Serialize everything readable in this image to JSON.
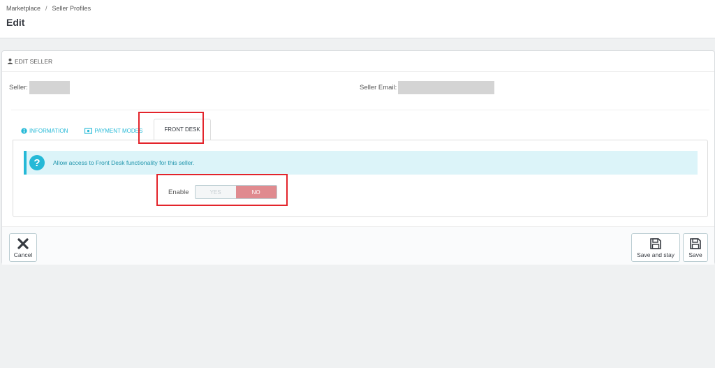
{
  "breadcrumb": {
    "item1": "Marketplace",
    "item2": "Seller Profiles"
  },
  "page_title": "Edit",
  "panel": {
    "heading": "EDIT SELLER"
  },
  "fields": {
    "seller_label": "Seller:",
    "email_label": "Seller Email:"
  },
  "tabs": [
    {
      "label": "INFORMATION",
      "icon": "info-circle-icon"
    },
    {
      "label": "PAYMENT MODES",
      "icon": "money-icon"
    },
    {
      "label": "FRONT DESK",
      "active": true
    }
  ],
  "front_desk": {
    "alert_text": "Allow access to Front Desk functionality for this seller.",
    "enable_label": "Enable",
    "yes_label": "YES",
    "no_label": "NO",
    "selected": "NO"
  },
  "footer": {
    "cancel_label": "Cancel",
    "save_stay_label": "Save and stay",
    "save_label": "Save"
  },
  "colors": {
    "accent": "#25b9d7",
    "no_active": "#e08a8f",
    "highlight": "#e3242b"
  }
}
